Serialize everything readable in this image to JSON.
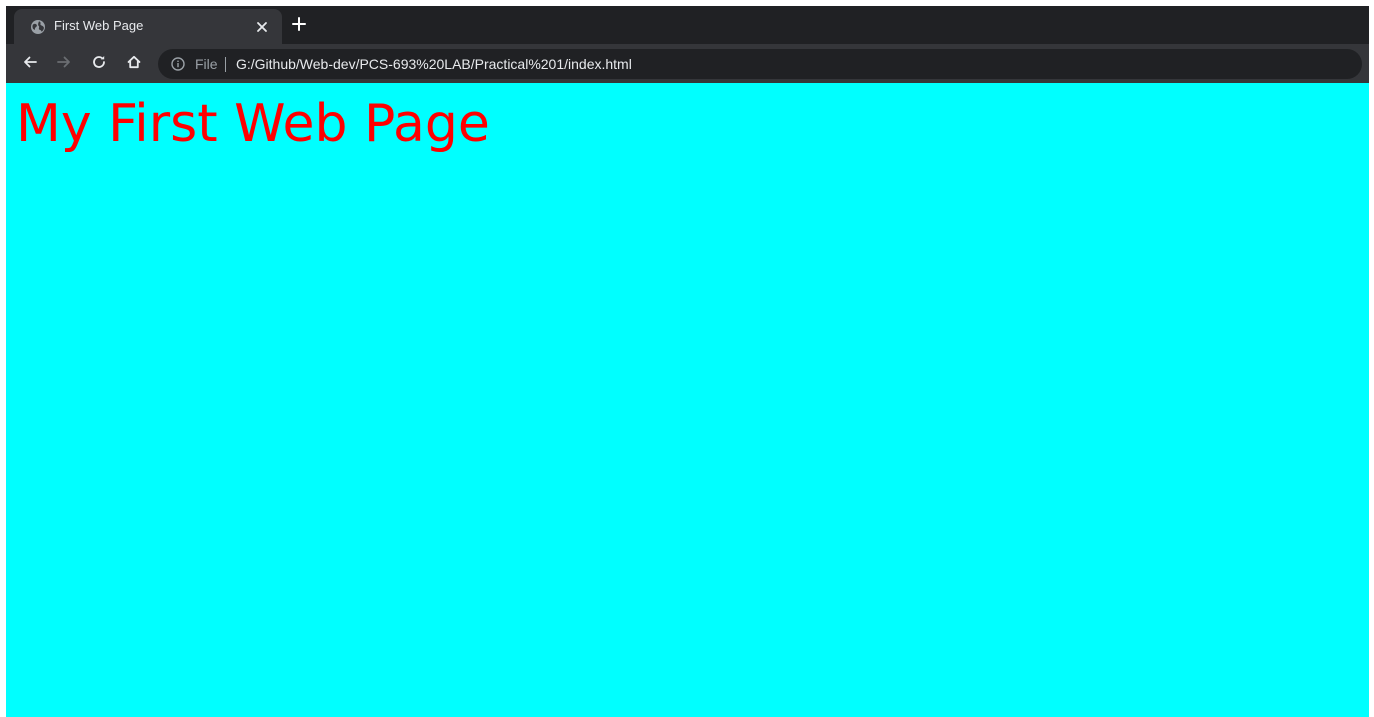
{
  "browser": {
    "tab": {
      "title": "First Web Page",
      "favicon": "globe-icon",
      "close": "close-icon"
    },
    "new_tab": "plus-icon",
    "toolbar": {
      "back": "arrow-left-icon",
      "forward": "arrow-right-icon",
      "reload": "reload-icon",
      "home": "home-icon"
    },
    "omnibox": {
      "security_icon": "info-icon",
      "scheme": "File",
      "url": "G:/Github/Web-dev/PCS-693%20LAB/Practical%201/index.html"
    }
  },
  "page": {
    "heading": "My First Web Page",
    "background_color": "#00ffff",
    "heading_color": "#ff0000"
  },
  "colors": {
    "tab_strip": "#202124",
    "toolbar": "#35363a",
    "omnibox": "#202124",
    "text_light": "#e8eaed",
    "text_dim": "#9aa0a6"
  }
}
